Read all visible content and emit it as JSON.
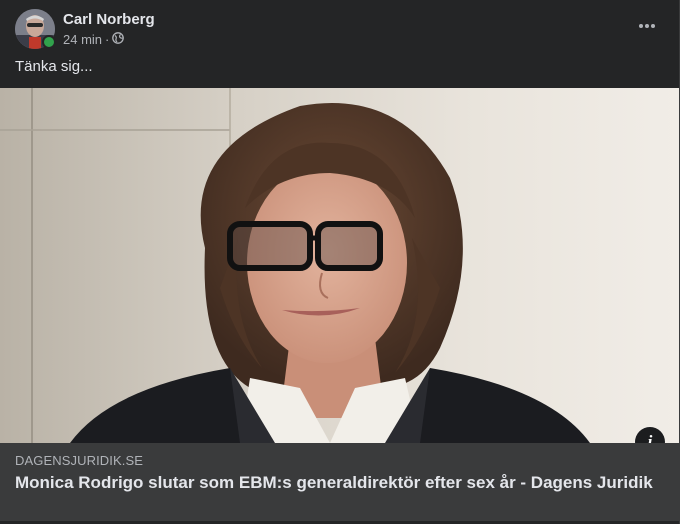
{
  "post": {
    "author": "Carl Norberg",
    "time": "24 min",
    "separator": "·",
    "privacy_icon": "globe-icon",
    "text": "Tänka sig...",
    "more_icon": "more-options-icon",
    "online": true
  },
  "link": {
    "domain": "DAGENSJURIDIK.SE",
    "title": "Monica Rodrigo slutar som EBM:s generaldirektör efter sex år - Dagens Juridik",
    "info_icon_label": "i"
  },
  "colors": {
    "background": "#242526",
    "link_box": "#3a3b3c",
    "online": "#31a24c",
    "text_primary": "#e4e6eb",
    "text_secondary": "#b0b3b8"
  }
}
